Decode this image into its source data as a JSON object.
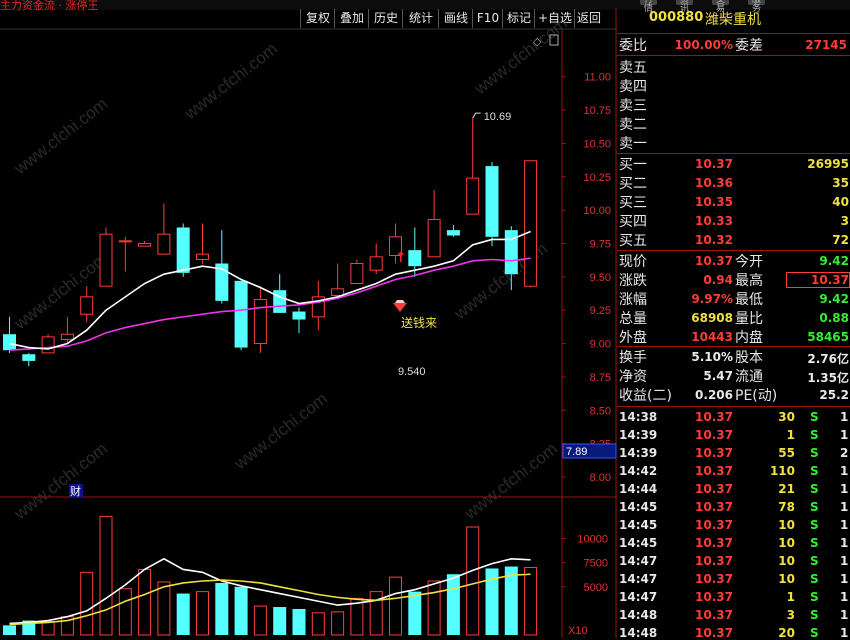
{
  "window": {
    "title_fragment": "主力资金流 · 涨停王",
    "top_tabs": [
      "行情",
      "资讯",
      "交易",
      "服务"
    ]
  },
  "toolbar": {
    "buttons": [
      "复权",
      "叠加",
      "历史",
      "统计",
      "画线",
      "F10",
      "标记",
      "+自选",
      "返回"
    ]
  },
  "stock": {
    "code": "000880",
    "name": "潍柴重机"
  },
  "order_book": {
    "weibi_label": "委比",
    "weibi_value": "100.00%",
    "weicha_label": "委差",
    "weicha_value": "27145",
    "sell_levels": [
      {
        "label": "卖五",
        "price": "",
        "vol": ""
      },
      {
        "label": "卖四",
        "price": "",
        "vol": ""
      },
      {
        "label": "卖三",
        "price": "",
        "vol": ""
      },
      {
        "label": "卖二",
        "price": "",
        "vol": ""
      },
      {
        "label": "卖一",
        "price": "",
        "vol": ""
      }
    ],
    "buy_levels": [
      {
        "label": "买一",
        "price": "10.37",
        "vol": "26995"
      },
      {
        "label": "买二",
        "price": "10.36",
        "vol": "35"
      },
      {
        "label": "买三",
        "price": "10.35",
        "vol": "40"
      },
      {
        "label": "买四",
        "price": "10.33",
        "vol": "3"
      },
      {
        "label": "买五",
        "price": "10.32",
        "vol": "72"
      }
    ]
  },
  "quote": {
    "rows": [
      {
        "l1": "现价",
        "v1": "10.37",
        "c1": "red",
        "l2": "今开",
        "v2": "9.42",
        "c2": "green"
      },
      {
        "l1": "涨跌",
        "v1": "0.94",
        "c1": "red",
        "l2": "最高",
        "v2": "10.37",
        "c2": "red"
      },
      {
        "l1": "涨幅",
        "v1": "9.97%",
        "c1": "red",
        "l2": "最低",
        "v2": "9.42",
        "c2": "green"
      },
      {
        "l1": "总量",
        "v1": "68908",
        "c1": "yellow",
        "l2": "量比",
        "v2": "0.88",
        "c2": "green"
      },
      {
        "l1": "外盘",
        "v1": "10443",
        "c1": "red",
        "l2": "内盘",
        "v2": "58465",
        "c2": "green"
      }
    ],
    "fund_rows": [
      {
        "l1": "换手",
        "v1": "5.10%",
        "l2": "股本",
        "v2": "2.76亿"
      },
      {
        "l1": "净资",
        "v1": "5.47",
        "l2": "流通",
        "v2": "1.35亿"
      },
      {
        "l1": "收益(二)",
        "v1": "0.206",
        "l2": "PE(动)",
        "v2": "25.2"
      }
    ]
  },
  "ticks": [
    {
      "time": "14:38",
      "price": "10.37",
      "vol": "30",
      "bs": "S",
      "n": "1"
    },
    {
      "time": "14:39",
      "price": "10.37",
      "vol": "1",
      "bs": "S",
      "n": "1"
    },
    {
      "time": "14:39",
      "price": "10.37",
      "vol": "55",
      "bs": "S",
      "n": "2"
    },
    {
      "time": "14:42",
      "price": "10.37",
      "vol": "110",
      "bs": "S",
      "n": "1"
    },
    {
      "time": "14:44",
      "price": "10.37",
      "vol": "21",
      "bs": "S",
      "n": "1"
    },
    {
      "time": "14:45",
      "price": "10.37",
      "vol": "78",
      "bs": "S",
      "n": "1"
    },
    {
      "time": "14:45",
      "price": "10.37",
      "vol": "10",
      "bs": "S",
      "n": "1"
    },
    {
      "time": "14:45",
      "price": "10.37",
      "vol": "10",
      "bs": "S",
      "n": "1"
    },
    {
      "time": "14:47",
      "price": "10.37",
      "vol": "10",
      "bs": "S",
      "n": "1"
    },
    {
      "time": "14:47",
      "price": "10.37",
      "vol": "10",
      "bs": "S",
      "n": "1"
    },
    {
      "time": "14:47",
      "price": "10.37",
      "vol": "1",
      "bs": "S",
      "n": "1"
    },
    {
      "time": "14:48",
      "price": "10.37",
      "vol": "3",
      "bs": "S",
      "n": "1"
    },
    {
      "time": "14:48",
      "price": "10.37",
      "vol": "20",
      "bs": "S",
      "n": "1"
    }
  ],
  "annotations": {
    "high_label": "10.69",
    "low_label": "9.540",
    "marker_text": "送钱来",
    "fin_badge": "财",
    "axis_cursor_value": "7.89",
    "vol_unit": "X10",
    "watermark": "www.cfchi.com"
  },
  "colors": {
    "up": "#ff3b3b",
    "down": "#55ffff",
    "ma_short": "#ffffff",
    "ma_long": "#ee33ee",
    "vol_ma1": "#ffffff",
    "vol_ma2": "#f0e040",
    "axis": "#a01010",
    "quote_red": "#ff3b3b"
  },
  "chart_data": [
    {
      "type": "candlestick",
      "title": "",
      "y_ticks": [
        8.0,
        8.25,
        8.5,
        8.75,
        9.0,
        9.25,
        9.5,
        9.75,
        10.0,
        10.25,
        10.5,
        10.75,
        11.0
      ],
      "ylim": [
        7.85,
        11.35
      ],
      "candles": [
        {
          "o": 9.07,
          "c": 8.95,
          "h": 9.2,
          "l": 8.93
        },
        {
          "o": 8.92,
          "c": 8.87,
          "h": 8.93,
          "l": 8.83
        },
        {
          "o": 8.93,
          "c": 9.05,
          "h": 9.07,
          "l": 8.93
        },
        {
          "o": 9.03,
          "c": 9.07,
          "h": 9.2,
          "l": 9.0
        },
        {
          "o": 9.22,
          "c": 9.35,
          "h": 9.43,
          "l": 9.16
        },
        {
          "o": 9.43,
          "c": 9.82,
          "h": 9.87,
          "l": 9.43
        },
        {
          "o": 9.77,
          "c": 9.77,
          "h": 9.8,
          "l": 9.54
        },
        {
          "o": 9.73,
          "c": 9.75,
          "h": 9.77,
          "l": 9.73
        },
        {
          "o": 9.67,
          "c": 9.82,
          "h": 10.05,
          "l": 9.67
        },
        {
          "o": 9.87,
          "c": 9.53,
          "h": 9.9,
          "l": 9.5
        },
        {
          "o": 9.63,
          "c": 9.67,
          "h": 9.9,
          "l": 9.6
        },
        {
          "o": 9.6,
          "c": 9.32,
          "h": 9.85,
          "l": 9.3
        },
        {
          "o": 9.47,
          "c": 8.97,
          "h": 9.47,
          "l": 8.95
        },
        {
          "o": 9.0,
          "c": 9.33,
          "h": 9.43,
          "l": 8.93
        },
        {
          "o": 9.4,
          "c": 9.23,
          "h": 9.52,
          "l": 9.23
        },
        {
          "o": 9.24,
          "c": 9.18,
          "h": 9.27,
          "l": 9.08
        },
        {
          "o": 9.2,
          "c": 9.35,
          "h": 9.47,
          "l": 9.1
        },
        {
          "o": 9.36,
          "c": 9.41,
          "h": 9.6,
          "l": 9.36
        },
        {
          "o": 9.45,
          "c": 9.6,
          "h": 9.63,
          "l": 9.45
        },
        {
          "o": 9.55,
          "c": 9.65,
          "h": 9.75,
          "l": 9.52
        },
        {
          "o": 9.66,
          "c": 9.8,
          "h": 9.9,
          "l": 9.6
        },
        {
          "o": 9.7,
          "c": 9.58,
          "h": 9.87,
          "l": 9.5
        },
        {
          "o": 9.65,
          "c": 9.93,
          "h": 10.15,
          "l": 9.65
        },
        {
          "o": 9.85,
          "c": 9.81,
          "h": 9.89,
          "l": 9.8
        },
        {
          "o": 9.97,
          "c": 10.24,
          "h": 10.69,
          "l": 9.97
        },
        {
          "o": 10.33,
          "c": 9.8,
          "h": 10.36,
          "l": 9.73
        },
        {
          "o": 9.85,
          "c": 9.52,
          "h": 9.88,
          "l": 9.4
        },
        {
          "o": 9.43,
          "c": 10.37,
          "h": 10.37,
          "l": 9.42
        }
      ],
      "ma_short": [
        9.0,
        8.97,
        8.96,
        9.0,
        9.1,
        9.25,
        9.35,
        9.45,
        9.52,
        9.55,
        9.58,
        9.56,
        9.48,
        9.42,
        9.35,
        9.3,
        9.32,
        9.35,
        9.4,
        9.45,
        9.52,
        9.55,
        9.58,
        9.62,
        9.74,
        9.78,
        9.78,
        9.84
      ],
      "ma_long": [
        8.95,
        8.96,
        8.97,
        8.98,
        9.02,
        9.08,
        9.12,
        9.15,
        9.18,
        9.2,
        9.22,
        9.24,
        9.25,
        9.27,
        9.28,
        9.29,
        9.31,
        9.34,
        9.38,
        9.43,
        9.48,
        9.51,
        9.55,
        9.58,
        9.62,
        9.63,
        9.62,
        9.64
      ]
    },
    {
      "type": "bar",
      "title": "",
      "y_ticks": [
        5000,
        7500,
        10000
      ],
      "ylim": [
        0,
        14000
      ],
      "values": [
        1000,
        1500,
        1400,
        1900,
        6500,
        12300,
        4800,
        6800,
        5500,
        4300,
        4500,
        5400,
        5000,
        3000,
        2900,
        2700,
        2300,
        2400,
        3800,
        4500,
        6000,
        4500,
        5600,
        6300,
        11200,
        6900,
        7100,
        7000
      ],
      "vol_ma1": [
        1200,
        1300,
        1500,
        1900,
        2500,
        3800,
        5200,
        6800,
        7900,
        6800,
        6500,
        5600,
        5100,
        4700,
        4300,
        3900,
        3500,
        3100,
        3300,
        3600,
        4300,
        4700,
        5300,
        5900,
        6700,
        7400,
        7900,
        7800
      ],
      "vol_ma2": [
        1100,
        1200,
        1300,
        1500,
        2000,
        2600,
        3500,
        4200,
        5000,
        5400,
        5600,
        5700,
        5600,
        5400,
        5000,
        4600,
        4200,
        3900,
        3700,
        3600,
        3800,
        4100,
        4400,
        4800,
        5300,
        5800,
        6200,
        6300
      ]
    }
  ]
}
